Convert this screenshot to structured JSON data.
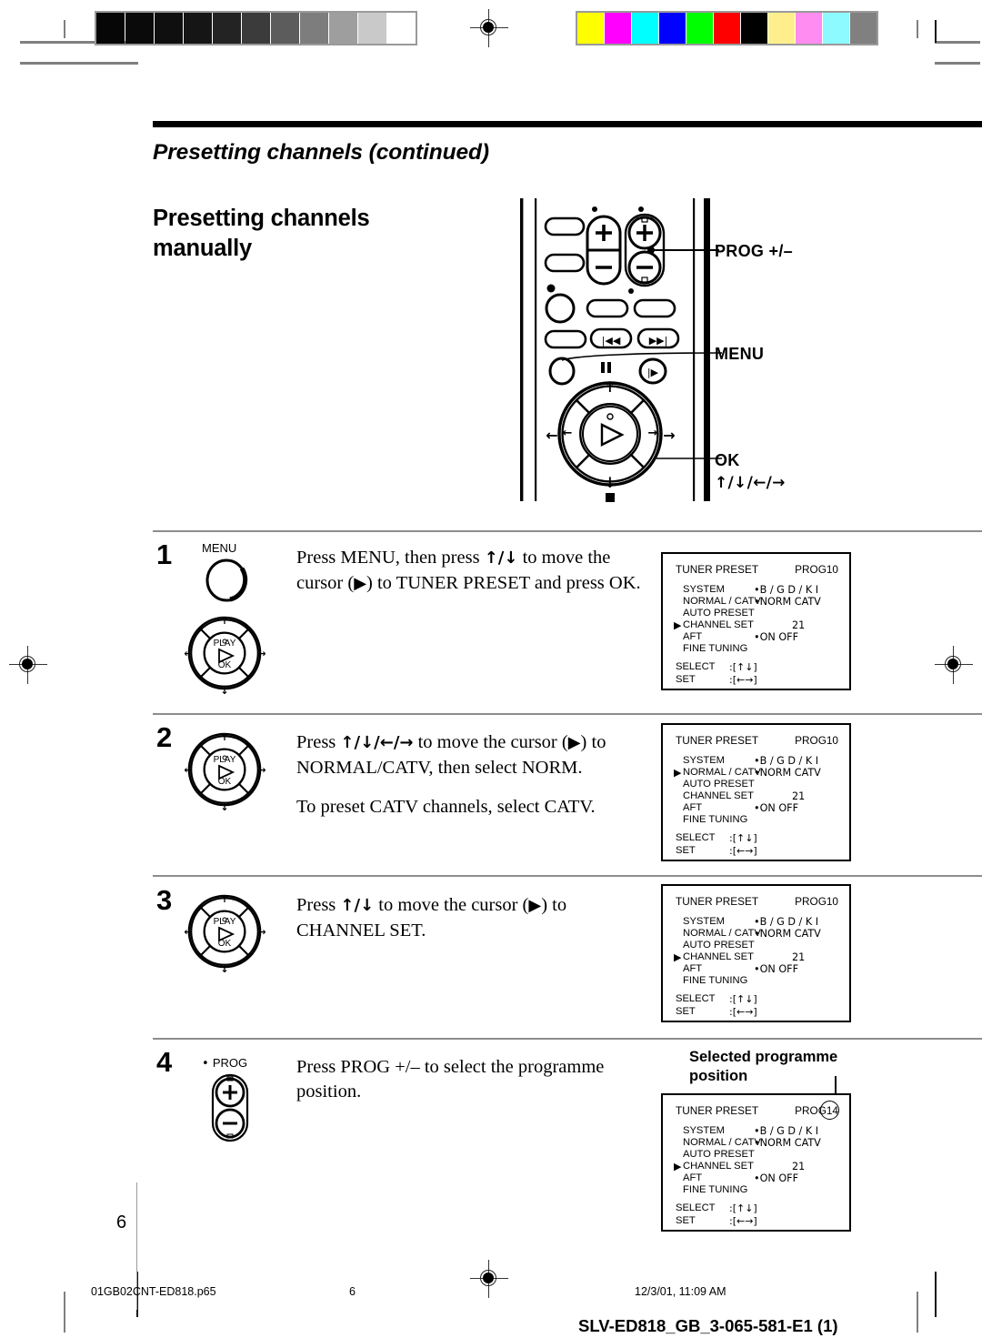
{
  "page": {
    "running_head": "Presetting channels (continued)",
    "section_title_line1": "Presetting channels",
    "section_title_line2": "manually",
    "page_number": "6"
  },
  "remote_callouts": {
    "prog": "PROG +/–",
    "menu": "MENU",
    "ok": "OK",
    "ok_arrows": "/ / /"
  },
  "steps": [
    {
      "number": "1",
      "button_label": "MENU",
      "text_html": "Press MENU, then press &#10003;/&#10003; to move the cursor (&#9654;) to TUNER PRESET and press OK.",
      "text_plain": "Press MENU, then press / to move the cursor ( ) to TUNER PRESET and press OK.",
      "text_part1": "Press MENU, then press ",
      "text_part2": " to move the cursor (",
      "text_part3": ") to TUNER PRESET and press OK.",
      "text2": ""
    },
    {
      "number": "2",
      "button_label": "",
      "text_part1": "Press ",
      "text_part2": " to move the cursor (",
      "text_part3": ") to NORMAL/CATV, then select NORM.",
      "text2": "To preset CATV channels, select CATV."
    },
    {
      "number": "3",
      "button_label": "",
      "text_part1": "Press ",
      "text_part2": " to move the cursor (",
      "text_part3": ") to CHANNEL SET.",
      "text2": ""
    },
    {
      "number": "4",
      "button_label": "PROG",
      "text_part1": "Press PROG +/– to select the programme position.",
      "text_part2": "",
      "text_part3": "",
      "text2": ""
    }
  ],
  "callout": {
    "line1": "Selected programme",
    "line2": "position"
  },
  "osd_screens": [
    {
      "title": "TUNER PRESET",
      "prog": "PROG10",
      "prog_base": "PROG",
      "prog_value": "10",
      "cursor_row": 3,
      "highlight_prog": false,
      "rows": [
        {
          "label": "SYSTEM",
          "values": "•B / G    D / K     I"
        },
        {
          "label": "NORMAL / CATV",
          "values": "•NORM  CATV"
        },
        {
          "label": "AUTO PRESET",
          "values": ""
        },
        {
          "label": "CHANNEL SET",
          "values": "21"
        },
        {
          "label": "AFT",
          "values": "•ON          OFF"
        },
        {
          "label": "FINE TUNING",
          "values": ""
        }
      ],
      "select_label": "SELECT",
      "select_keys": ":[   ]",
      "set_label": "SET",
      "set_keys": ":[   ]"
    },
    {
      "title": "TUNER PRESET",
      "prog": "PROG10",
      "prog_base": "PROG",
      "prog_value": "10",
      "cursor_row": 1,
      "highlight_prog": false,
      "rows": [
        {
          "label": "SYSTEM",
          "values": "•B / G    D / K     I"
        },
        {
          "label": "NORMAL / CATV",
          "values": "•NORM  CATV"
        },
        {
          "label": "AUTO PRESET",
          "values": ""
        },
        {
          "label": "CHANNEL SET",
          "values": "21"
        },
        {
          "label": "AFT",
          "values": "•ON          OFF"
        },
        {
          "label": "FINE TUNING",
          "values": ""
        }
      ],
      "select_label": "SELECT",
      "select_keys": ":[   ]",
      "set_label": "SET",
      "set_keys": ":[   ]"
    },
    {
      "title": "TUNER PRESET",
      "prog": "PROG10",
      "prog_base": "PROG",
      "prog_value": "10",
      "cursor_row": 3,
      "highlight_prog": false,
      "rows": [
        {
          "label": "SYSTEM",
          "values": "•B / G    D / K     I"
        },
        {
          "label": "NORMAL / CATV",
          "values": "•NORM  CATV"
        },
        {
          "label": "AUTO PRESET",
          "values": ""
        },
        {
          "label": "CHANNEL SET",
          "values": "21"
        },
        {
          "label": "AFT",
          "values": "•ON          OFF"
        },
        {
          "label": "FINE TUNING",
          "values": ""
        }
      ],
      "select_label": "SELECT",
      "select_keys": ":[   ]",
      "set_label": "SET",
      "set_keys": ":[   ]"
    },
    {
      "title": "TUNER PRESET",
      "prog": "PROG14",
      "prog_base": "PROG",
      "prog_value": "14",
      "cursor_row": 3,
      "highlight_prog": true,
      "rows": [
        {
          "label": "SYSTEM",
          "values": "•B / G    D / K     I"
        },
        {
          "label": "NORMAL / CATV",
          "values": "•NORM  CATV"
        },
        {
          "label": "AUTO PRESET",
          "values": ""
        },
        {
          "label": "CHANNEL SET",
          "values": "21"
        },
        {
          "label": "AFT",
          "values": "•ON          OFF"
        },
        {
          "label": "FINE TUNING",
          "values": ""
        }
      ],
      "select_label": "SELECT",
      "select_keys": ":[   ]",
      "set_label": "SET",
      "set_keys": ":[   ]"
    }
  ],
  "footer": {
    "filename": "01GB02CNT-ED818.p65",
    "page": "6",
    "timestamp": "12/3/01, 11:09 AM",
    "doc_code": "SLV-ED818_GB_3-065-581-E1 (1)"
  },
  "colorbars": {
    "grayscale": [
      "#060606",
      "#0a0a0a",
      "#0f0f0f",
      "#151515",
      "#232323",
      "#3b3b3b",
      "#5c5c5c",
      "#7d7d7d",
      "#9e9e9e",
      "#c9c9c9",
      "#ffffff"
    ],
    "chroma": [
      "#ffff00",
      "#ff00ff",
      "#00ffff",
      "#0000ff",
      "#00ff00",
      "#ff0000",
      "#000000",
      "#ffef8c",
      "#ff8cf0",
      "#8cfaff",
      "#808080"
    ]
  }
}
